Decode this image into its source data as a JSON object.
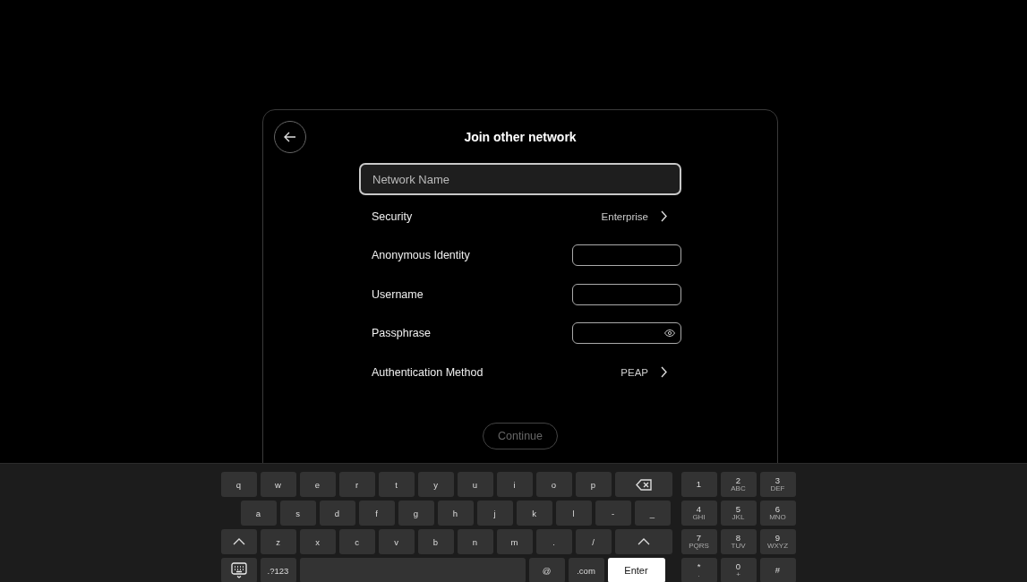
{
  "dialog": {
    "title": "Join other network",
    "network_name": {
      "placeholder": "Network Name"
    },
    "rows": [
      {
        "kind": "select",
        "label": "Security",
        "value": "Enterprise"
      },
      {
        "kind": "input",
        "label": "Anonymous Identity"
      },
      {
        "kind": "input",
        "label": "Username"
      },
      {
        "kind": "password",
        "label": "Passphrase"
      },
      {
        "kind": "select",
        "label": "Authentication Method",
        "value": "PEAP"
      }
    ],
    "continue_button": {
      "label": "Continue",
      "disabled": true
    }
  },
  "keyboard": {
    "rows": [
      {
        "keys": [
          {
            "kind": "char",
            "label": "q"
          },
          {
            "kind": "char",
            "label": "w"
          },
          {
            "kind": "char",
            "label": "e"
          },
          {
            "kind": "char",
            "label": "r"
          },
          {
            "kind": "char",
            "label": "t"
          },
          {
            "kind": "char",
            "label": "y"
          },
          {
            "kind": "char",
            "label": "u"
          },
          {
            "kind": "char",
            "label": "i"
          },
          {
            "kind": "char",
            "label": "o"
          },
          {
            "kind": "char",
            "label": "p"
          },
          {
            "kind": "backspace"
          }
        ]
      },
      {
        "keys": [
          {
            "kind": "char",
            "label": "a"
          },
          {
            "kind": "char",
            "label": "s"
          },
          {
            "kind": "char",
            "label": "d"
          },
          {
            "kind": "char",
            "label": "f"
          },
          {
            "kind": "char",
            "label": "g"
          },
          {
            "kind": "char",
            "label": "h"
          },
          {
            "kind": "char",
            "label": "j"
          },
          {
            "kind": "char",
            "label": "k"
          },
          {
            "kind": "char",
            "label": "l"
          },
          {
            "kind": "char",
            "label": "-"
          },
          {
            "kind": "char",
            "label": "_"
          }
        ]
      },
      {
        "keys": [
          {
            "kind": "shift"
          },
          {
            "kind": "char",
            "label": "z"
          },
          {
            "kind": "char",
            "label": "x"
          },
          {
            "kind": "char",
            "label": "c"
          },
          {
            "kind": "char",
            "label": "v"
          },
          {
            "kind": "char",
            "label": "b"
          },
          {
            "kind": "char",
            "label": "n"
          },
          {
            "kind": "char",
            "label": "m"
          },
          {
            "kind": "char",
            "label": "."
          },
          {
            "kind": "char",
            "label": "/"
          },
          {
            "kind": "shift"
          }
        ]
      },
      {
        "keys": [
          {
            "kind": "hide"
          },
          {
            "kind": "char",
            "label": ".?123"
          },
          {
            "kind": "space"
          },
          {
            "kind": "char",
            "label": "@"
          },
          {
            "kind": "char",
            "label": ".com"
          },
          {
            "kind": "enter",
            "label": "Enter"
          }
        ]
      }
    ],
    "numpad": [
      {
        "label": "1"
      },
      {
        "label": "2",
        "sub": "ABC"
      },
      {
        "label": "3",
        "sub": "DEF"
      },
      {
        "label": "4",
        "sub": "GHI"
      },
      {
        "label": "5",
        "sub": "JKL"
      },
      {
        "label": "6",
        "sub": "MNO"
      },
      {
        "label": "7",
        "sub": "PQRS"
      },
      {
        "label": "8",
        "sub": "TUV"
      },
      {
        "label": "9",
        "sub": "WXYZ"
      },
      {
        "label": "*",
        "sub": "."
      },
      {
        "label": "0",
        "sub": "+"
      },
      {
        "label": "#"
      }
    ]
  }
}
